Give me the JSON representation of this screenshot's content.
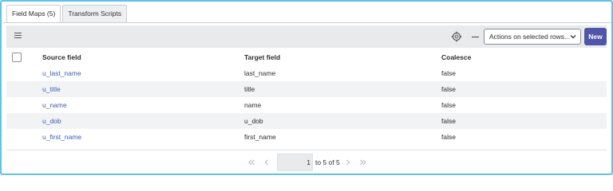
{
  "tabs": [
    {
      "label": "Field Maps (5)",
      "active": true
    },
    {
      "label": "Transform Scripts",
      "active": false
    }
  ],
  "toolbar": {
    "actions_select_value": "Actions on selected rows...",
    "new_label": "New"
  },
  "table": {
    "headers": [
      "Source field",
      "Target field",
      "Coalesce"
    ],
    "rows": [
      {
        "source": "u_last_name",
        "target": "last_name",
        "coalesce": "false"
      },
      {
        "source": "u_title",
        "target": "title",
        "coalesce": "false"
      },
      {
        "source": "u_name",
        "target": "name",
        "coalesce": "false"
      },
      {
        "source": "u_dob",
        "target": "u_dob",
        "coalesce": "false"
      },
      {
        "source": "u_first_name",
        "target": "first_name",
        "coalesce": "false"
      }
    ]
  },
  "pagination": {
    "page": "1",
    "info": "to 5 of 5"
  },
  "icons": [
    "menu-icon",
    "gear-icon",
    "minus-icon",
    "chevron-down-icon",
    "first-page-icon",
    "previous-page-icon",
    "next-page-icon",
    "last-page-icon"
  ],
  "colors": {
    "accent": "#4f55a8",
    "link": "#3b5db5",
    "frame": "#5fc2e6"
  }
}
